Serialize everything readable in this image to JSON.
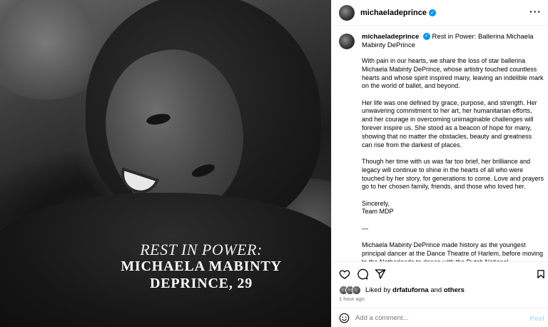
{
  "photo": {
    "overlay_line1": "REST IN POWER:",
    "overlay_line2": "MICHAELA MABINTY",
    "overlay_line3": "DEPRINCE, 29"
  },
  "header": {
    "username": "michaeladeprince",
    "verified_icon": "verified-badge-icon",
    "more_label": "···"
  },
  "caption": {
    "username": "michaeladeprince",
    "title": "Rest in Power: Ballerina Michaela Mabinty DePrince",
    "paragraphs": [
      "With pain in our hearts, we share the loss of star ballerina Michaela Mabinty DePrince, whose artistry touched countless hearts and whose spirit inspired many, leaving an indelible mark on the world of ballet, and beyond.",
      "Her life was one defined by grace, purpose, and strength. Her unwavering commitment to her art, her humanitarian efforts, and her courage in overcoming unimaginable challenges will forever inspire us. She stood as a beacon of hope for many, showing that no matter the obstacles, beauty and greatness can rise from the darkest of places.",
      "Though her time with us was far too brief, her brilliance and legacy will continue to shine in the hearts of all who were touched by her story, for generations to come. Love and prayers go to her chosen family, friends, and those who loved her.",
      "Sincerely,",
      "Team MDP",
      "—",
      "Michaela Mabinty DePrince made history as the youngest principal dancer at the Dance Theatre of Harlem, before moving to the Netherlands to dance with the Dutch National"
    ]
  },
  "actions": {
    "like_icon": "heart-icon",
    "comment_icon": "comment-icon",
    "share_icon": "share-icon",
    "save_icon": "bookmark-icon"
  },
  "likes": {
    "prefix": "Liked by",
    "user": "drfatuforna",
    "and": "and",
    "others": "others"
  },
  "time": "1 hour ago",
  "comment": {
    "placeholder": "Add a comment...",
    "post_label": "Post"
  },
  "colors": {
    "verified": "#0095f6",
    "post_disabled": "#b2dffc",
    "muted": "#737373"
  }
}
